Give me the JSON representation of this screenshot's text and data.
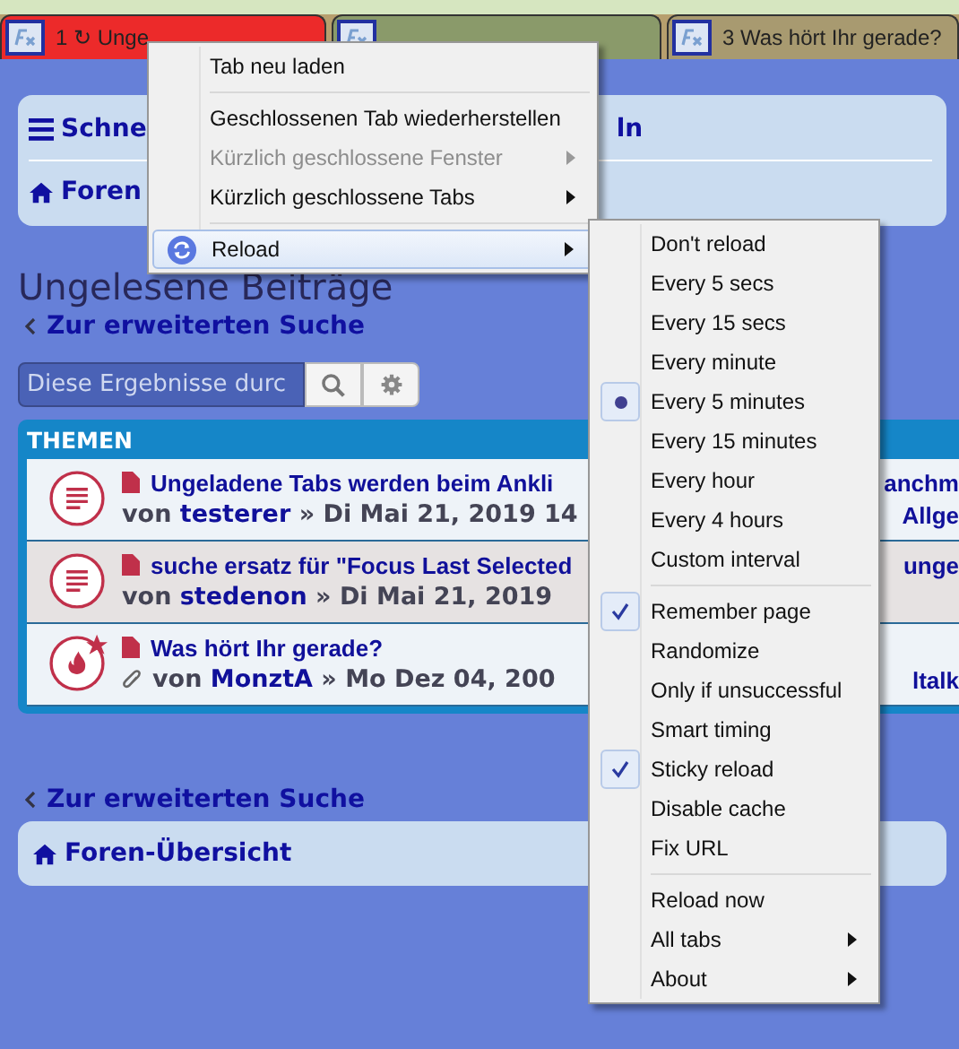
{
  "tabs": [
    {
      "label": "1 ↻ Unge",
      "selected": true
    },
    {
      "selected": false
    },
    {
      "label": "3 Was hört Ihr gerade?",
      "selected": false
    }
  ],
  "nav": {
    "menu_label": "Schne",
    "menu_label_end": "ln",
    "home_label": "Foren"
  },
  "heading": "Ungelesene Beiträge",
  "back_link": "Zur erweiterten Suche",
  "search": {
    "placeholder": "Diese Ergebnisse durc"
  },
  "topics": {
    "header": "THEMEN",
    "rows": [
      {
        "kind": "read",
        "title": "Ungeladene Tabs werden beim Ankli",
        "title_end": "anchm",
        "prefix": "von",
        "author": "testerer",
        "separator": "»",
        "date": "Di Mai 21, 2019 14",
        "meta_end": "Allge",
        "attachment": false
      },
      {
        "kind": "read",
        "title": "suche ersatz für \"Focus Last Selected",
        "title_end": "unge",
        "prefix": "von",
        "author": "stedenon",
        "separator": "»",
        "date": "Di Mai 21, 2019",
        "attachment": false
      },
      {
        "kind": "hot",
        "title": "Was hört Ihr gerade?",
        "prefix": "von",
        "author": "MonztA",
        "separator": "»",
        "date": "Mo Dez 04, 200",
        "meta_end": "ltalk",
        "attachment": true
      }
    ]
  },
  "bottom_link": "Zur erweiterten Suche",
  "bottom_home": "Foren-Übersicht",
  "context_menu": {
    "groups": [
      [
        {
          "label": "Tab neu laden",
          "disabled": false,
          "has_submenu": false,
          "highlighted": false
        }
      ],
      [
        {
          "label": "Geschlossenen Tab wiederherstellen",
          "disabled": false,
          "has_submenu": false,
          "highlighted": false
        },
        {
          "label": "Kürzlich geschlossene Fenster",
          "disabled": true,
          "has_submenu": true,
          "highlighted": false
        },
        {
          "label": "Kürzlich geschlossene Tabs",
          "disabled": false,
          "has_submenu": true,
          "highlighted": false
        }
      ],
      [
        {
          "label": "Reload",
          "disabled": false,
          "has_submenu": true,
          "highlighted": true
        }
      ]
    ]
  },
  "reload_submenu": {
    "groups": [
      [
        {
          "kind": "radio",
          "label": "Don't reload",
          "selected": false
        },
        {
          "kind": "radio",
          "label": "Every 5 secs",
          "selected": false
        },
        {
          "kind": "radio",
          "label": "Every 15 secs",
          "selected": false
        },
        {
          "kind": "radio",
          "label": "Every minute",
          "selected": false
        },
        {
          "kind": "radio",
          "label": "Every 5 minutes",
          "selected": true
        },
        {
          "kind": "radio",
          "label": "Every 15 minutes",
          "selected": false
        },
        {
          "kind": "radio",
          "label": "Every hour",
          "selected": false
        },
        {
          "kind": "radio",
          "label": "Every 4 hours",
          "selected": false
        },
        {
          "kind": "action",
          "label": "Custom interval"
        }
      ],
      [
        {
          "kind": "check",
          "label": "Remember page",
          "checked": true
        },
        {
          "kind": "check",
          "label": "Randomize",
          "checked": false
        },
        {
          "kind": "check",
          "label": "Only if unsuccessful",
          "checked": false
        },
        {
          "kind": "check",
          "label": "Smart timing",
          "checked": false
        },
        {
          "kind": "check",
          "label": "Sticky reload",
          "checked": true
        },
        {
          "kind": "check",
          "label": "Disable cache",
          "checked": false
        },
        {
          "kind": "action",
          "label": "Fix URL"
        }
      ],
      [
        {
          "kind": "action",
          "label": "Reload now"
        },
        {
          "kind": "submenu",
          "label": "All tabs"
        },
        {
          "kind": "submenu",
          "label": "About"
        }
      ]
    ]
  }
}
